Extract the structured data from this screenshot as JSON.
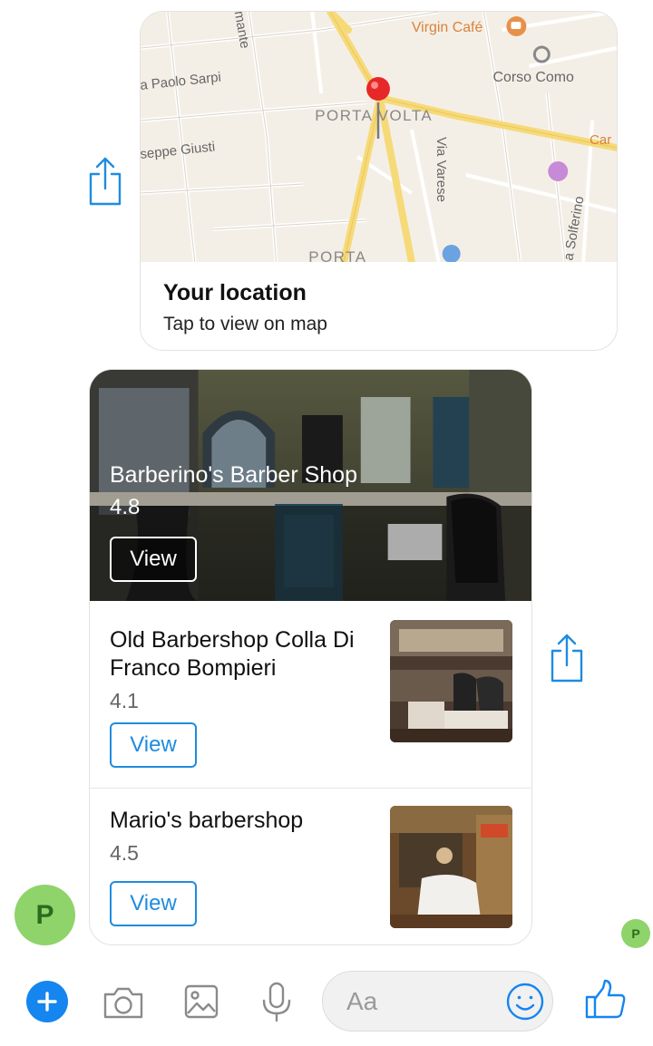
{
  "location_card": {
    "map_labels": {
      "virgin_cafe": "Virgin Café",
      "corso_como": "Corso Como",
      "paolo_sarpi": "a Paolo Sarpi",
      "porta_volta": "PORTA VOLTA",
      "giusti": "seppe Giusti",
      "via_varese": "Via Varese",
      "solferino": "a Solferino",
      "car": "Car",
      "porta": "PORTA",
      "mante": "mante"
    },
    "title": "Your location",
    "subtitle": "Tap to view on map"
  },
  "list_card": {
    "featured": {
      "name": "Barberino's Barber Shop",
      "rating": "4.8",
      "button": "View"
    },
    "items": [
      {
        "name": "Old Barbershop Colla Di Franco Bompieri",
        "rating": "4.1",
        "button": "View"
      },
      {
        "name": "Mario's barbershop",
        "rating": "4.5",
        "button": "View"
      }
    ]
  },
  "avatars": {
    "sender_initial": "P",
    "read_receipt_initial": "P"
  },
  "composer": {
    "placeholder": "Aa"
  },
  "colors": {
    "accent": "#1585f0",
    "avatar_bg": "#8fd36b",
    "icon_gray": "#8a8a8a",
    "share_blue": "#1e8ce0"
  },
  "icons": [
    "share-icon",
    "map-pin-icon",
    "plus-icon",
    "camera-icon",
    "image-icon",
    "microphone-icon",
    "emoji-icon",
    "thumbs-up-icon"
  ]
}
